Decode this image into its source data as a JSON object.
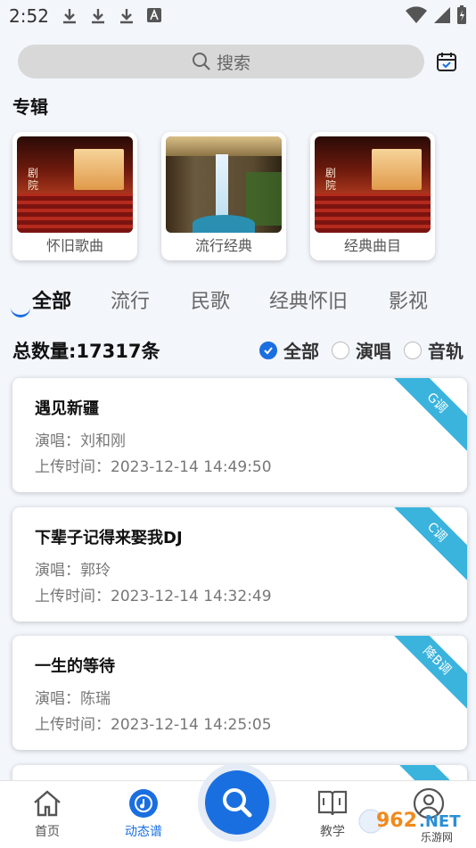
{
  "status_bar": {
    "time": "2:52"
  },
  "search": {
    "placeholder": "搜索"
  },
  "albums_section": {
    "title": "专辑"
  },
  "albums": [
    {
      "label": "怀旧歌曲",
      "sign": "剧院"
    },
    {
      "label": "流行经典"
    },
    {
      "label": "经典曲目",
      "sign": "剧院"
    }
  ],
  "tabs": [
    "全部",
    "流行",
    "民歌",
    "经典怀旧",
    "影视"
  ],
  "active_tab": "全部",
  "summary": {
    "total": "总数量:17317条"
  },
  "filters": [
    {
      "label": "全部",
      "checked": true
    },
    {
      "label": "演唱",
      "checked": false
    },
    {
      "label": "音轨",
      "checked": false
    }
  ],
  "songs": [
    {
      "title": "遇见新疆",
      "singer": "演唱：刘和刚",
      "uploaded": "上传时间：2023-12-14 14:49:50",
      "key": "G调"
    },
    {
      "title": "下辈子记得来娶我DJ",
      "singer": "演唱：郭玲",
      "uploaded": "上传时间：2023-12-14 14:32:49",
      "key": "C调"
    },
    {
      "title": "一生的等待",
      "singer": "演唱：陈瑞",
      "uploaded": "上传时间：2023-12-14 14:25:05",
      "key": "降B调"
    }
  ],
  "bottom_nav": {
    "home": "首页",
    "dynamic_score": "动态谱",
    "teaching": "教学"
  },
  "watermark": {
    "text": "962.NET",
    "subtext": "乐游网"
  },
  "colors": {
    "accent": "#1a6fe0",
    "ribbon": "#3ab3dd",
    "background": "#f3f6fb"
  }
}
